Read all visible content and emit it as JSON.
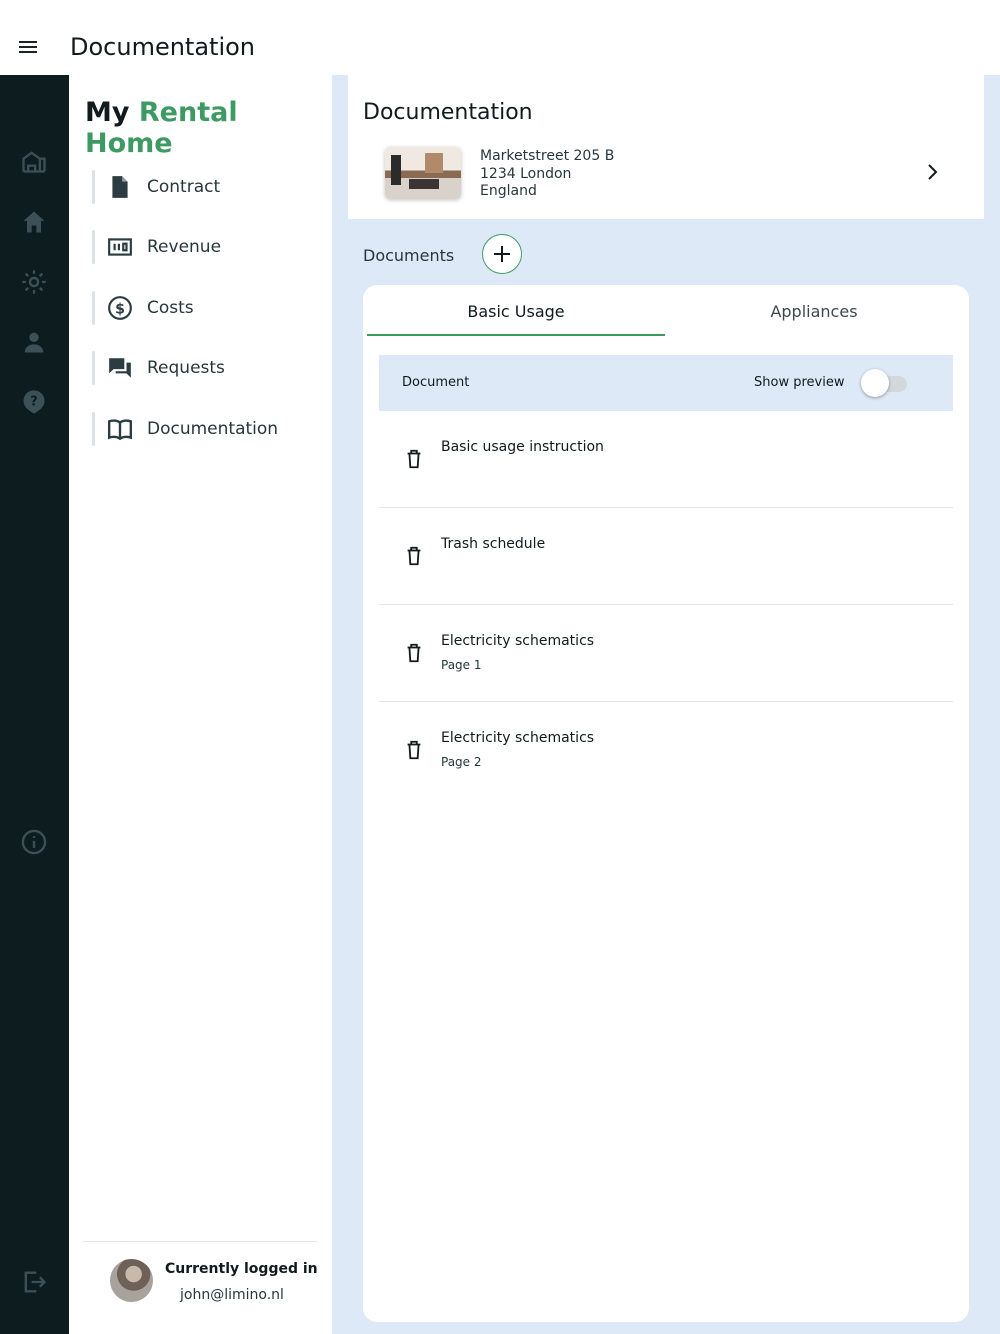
{
  "topbar": {
    "title": "Documentation"
  },
  "rail": {
    "icons": [
      "buildings-icon",
      "home-icon",
      "settings-icon",
      "person-icon",
      "help-icon",
      "info-icon",
      "logout-icon"
    ]
  },
  "nav": {
    "brand_prefix": "My",
    "brand_accent": "Rental Home",
    "items": [
      {
        "label": "Contract",
        "icon": "document-icon"
      },
      {
        "label": "Revenue",
        "icon": "money-icon"
      },
      {
        "label": "Costs",
        "icon": "dollar-circle-icon"
      },
      {
        "label": "Requests",
        "icon": "chat-icon"
      },
      {
        "label": "Documentation",
        "icon": "book-icon"
      }
    ],
    "login_label": "Currently logged in",
    "login_email": "john@limino.nl"
  },
  "header": {
    "title": "Documentation",
    "address_line1": "Marketstreet 205 B",
    "address_line2": "1234 London",
    "address_line3": "England"
  },
  "documents": {
    "label": "Documents",
    "tabs": [
      "Basic Usage",
      "Appliances"
    ],
    "active_tab": "Basic Usage",
    "col_document": "Document",
    "col_preview": "Show preview",
    "preview_on": false,
    "rows": [
      {
        "title": "Basic usage instruction",
        "subtitle": ""
      },
      {
        "title": "Trash schedule",
        "subtitle": ""
      },
      {
        "title": "Electricity schematics",
        "subtitle": "Page 1"
      },
      {
        "title": "Electricity schematics",
        "subtitle": "Page 2"
      }
    ]
  },
  "colors": {
    "accent": "#3e9a63",
    "rail": "#0d1c1f",
    "main_bg": "#dde9f7"
  }
}
